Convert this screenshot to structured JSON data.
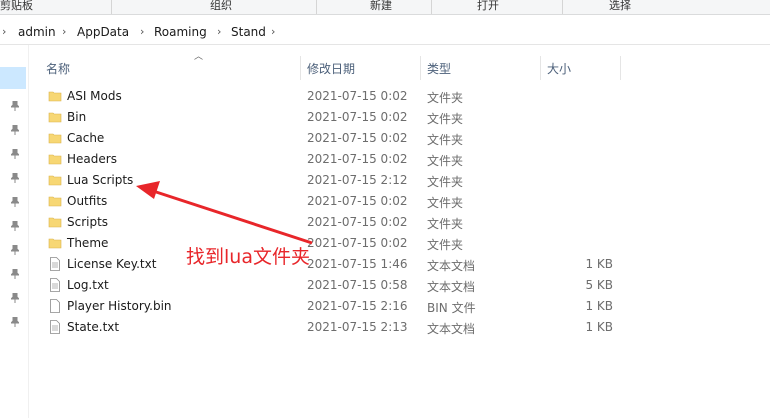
{
  "ribbon": {
    "groups": [
      "剪贴板",
      "组织",
      "新建",
      "打开",
      "选择"
    ]
  },
  "breadcrumb": [
    "admin",
    "AppData",
    "Roaming",
    "Stand"
  ],
  "columns": {
    "name": "名称",
    "date": "修改日期",
    "type": "类型",
    "size": "大小"
  },
  "files": [
    {
      "name": "ASI Mods",
      "date": "2021-07-15 0:02",
      "type": "文件夹",
      "size": "",
      "icon": "folder-icon"
    },
    {
      "name": "Bin",
      "date": "2021-07-15 0:02",
      "type": "文件夹",
      "size": "",
      "icon": "folder-icon"
    },
    {
      "name": "Cache",
      "date": "2021-07-15 0:02",
      "type": "文件夹",
      "size": "",
      "icon": "folder-icon"
    },
    {
      "name": "Headers",
      "date": "2021-07-15 0:02",
      "type": "文件夹",
      "size": "",
      "icon": "folder-icon"
    },
    {
      "name": "Lua Scripts",
      "date": "2021-07-15 2:12",
      "type": "文件夹",
      "size": "",
      "icon": "folder-icon"
    },
    {
      "name": "Outfits",
      "date": "2021-07-15 0:02",
      "type": "文件夹",
      "size": "",
      "icon": "folder-icon"
    },
    {
      "name": "Scripts",
      "date": "2021-07-15 0:02",
      "type": "文件夹",
      "size": "",
      "icon": "folder-icon"
    },
    {
      "name": "Theme",
      "date": "2021-07-15 0:02",
      "type": "文件夹",
      "size": "",
      "icon": "folder-icon"
    },
    {
      "name": "License Key.txt",
      "date": "2021-07-15 1:46",
      "type": "文本文档",
      "size": "1 KB",
      "icon": "text-file-icon"
    },
    {
      "name": "Log.txt",
      "date": "2021-07-15 0:58",
      "type": "文本文档",
      "size": "5 KB",
      "icon": "text-file-icon"
    },
    {
      "name": "Player History.bin",
      "date": "2021-07-15 2:16",
      "type": "BIN 文件",
      "size": "1 KB",
      "icon": "file-icon"
    },
    {
      "name": "State.txt",
      "date": "2021-07-15 2:13",
      "type": "文本文档",
      "size": "1 KB",
      "icon": "text-file-icon"
    }
  ],
  "annotation": "找到lua文件夹",
  "colors": {
    "folder": "#f7d774",
    "annotation": "#e8262a",
    "header_text": "#4c607a"
  }
}
